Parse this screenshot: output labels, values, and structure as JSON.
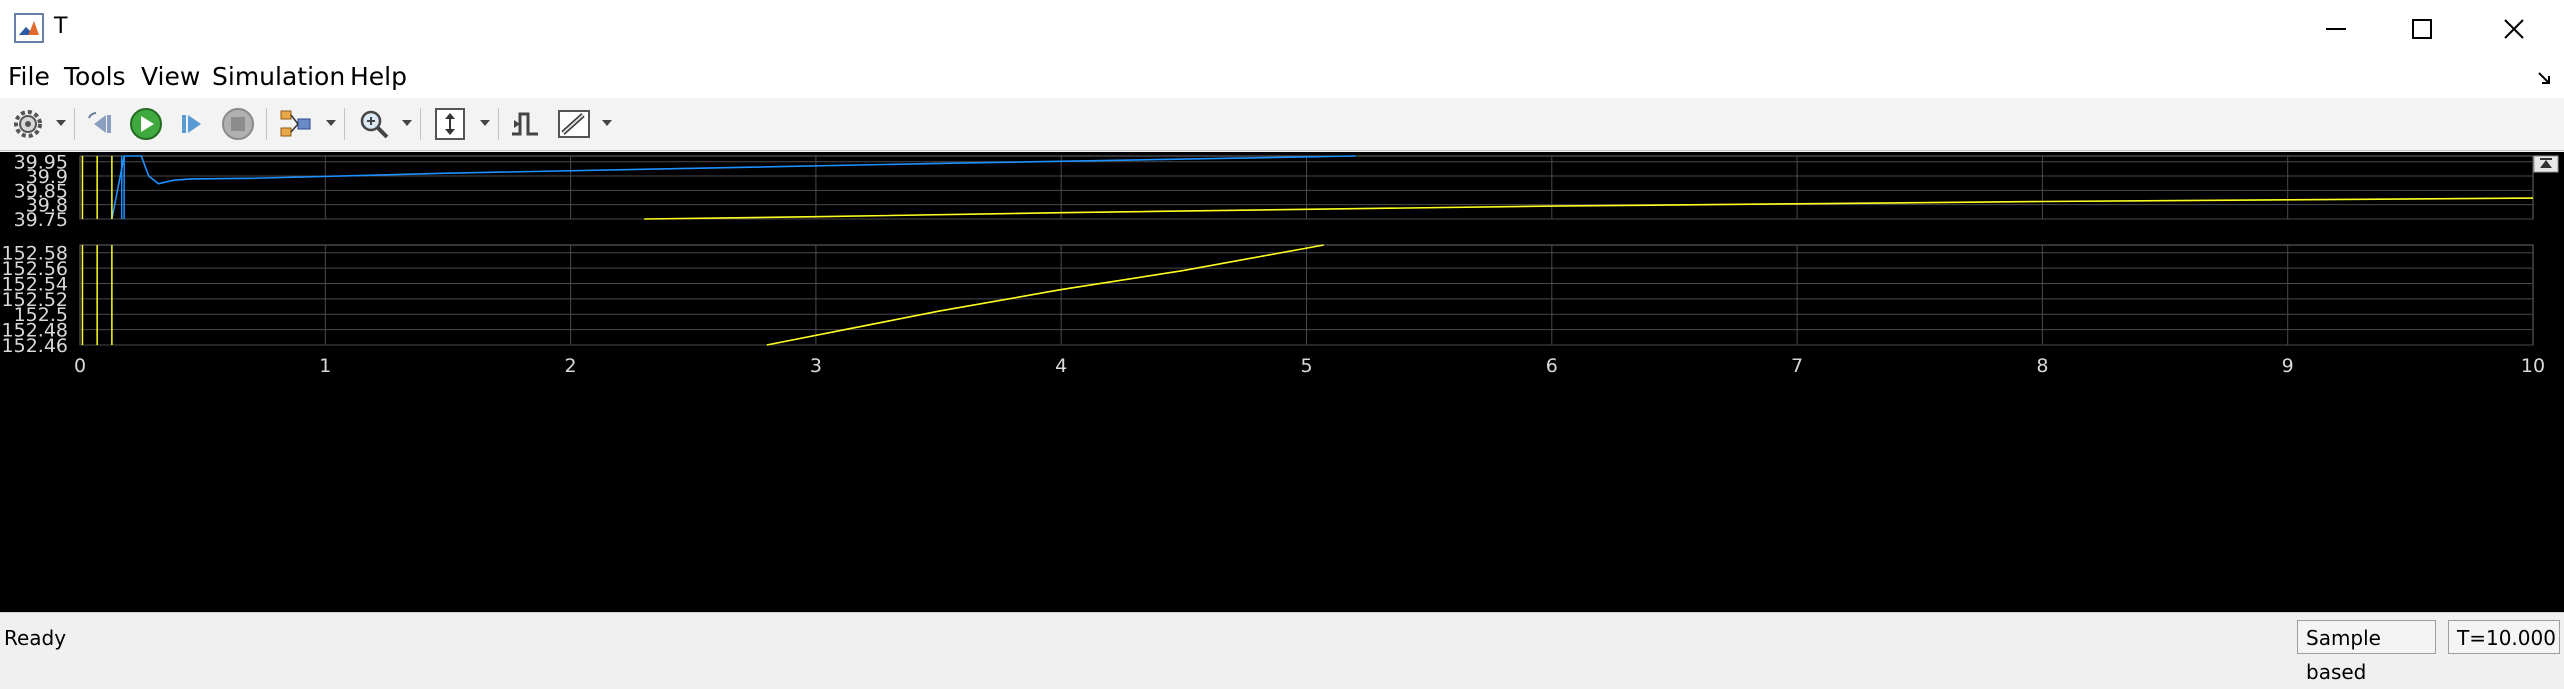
{
  "window": {
    "title": "T"
  },
  "menu": [
    "File",
    "Tools",
    "View",
    "Simulation",
    "Help"
  ],
  "toolbar": {
    "icons": [
      "settings-icon",
      "step-back-icon",
      "run-icon",
      "step-forward-icon",
      "stop-icon",
      "layout-icon",
      "zoom-icon",
      "scale-axes-icon",
      "triggers-icon",
      "measurements-icon"
    ]
  },
  "status": {
    "text": "Ready",
    "mode": "Sample based",
    "time": "T=10.000"
  },
  "colors": {
    "blue_trace": "#1e90ff",
    "yellow_trace": "#ffff22",
    "grid": "#4a4a4a",
    "background": "#000000",
    "axis_text": "#d9d9d9"
  },
  "chart_data": [
    {
      "type": "line",
      "xlim": [
        0,
        10
      ],
      "ylim": [
        39.75,
        39.97
      ],
      "y_ticks": [
        "39.95",
        "39.9",
        "39.85",
        "39.8",
        "39.75"
      ],
      "grid": true,
      "series": [
        {
          "color": "#1e90ff",
          "points": [
            [
              0.13,
              39.75
            ],
            [
              0.18,
              39.97
            ],
            [
              0.25,
              39.97
            ],
            [
              0.28,
              39.9
            ],
            [
              0.32,
              39.873
            ],
            [
              0.38,
              39.885
            ],
            [
              0.45,
              39.89
            ],
            [
              0.7,
              39.892
            ],
            [
              1.5,
              39.91
            ],
            [
              2.5,
              39.927
            ],
            [
              3.5,
              39.944
            ],
            [
              4.5,
              39.959
            ],
            [
              5.2,
              39.97
            ]
          ]
        },
        {
          "color": "#ffff22",
          "points": [
            [
              2.3,
              39.75
            ],
            [
              3,
              39.758
            ],
            [
              4,
              39.772
            ],
            [
              5,
              39.784
            ],
            [
              6,
              39.795
            ],
            [
              7,
              39.803
            ],
            [
              8,
              39.811
            ],
            [
              9,
              39.817
            ],
            [
              10,
              39.823
            ]
          ]
        }
      ]
    },
    {
      "type": "line",
      "xlim": [
        0,
        10
      ],
      "ylim": [
        152.46,
        152.59
      ],
      "y_ticks": [
        "152.58",
        "152.56",
        "152.54",
        "152.52",
        "152.5",
        "152.48",
        "152.46"
      ],
      "x_ticks": [
        "0",
        "1",
        "2",
        "3",
        "4",
        "5",
        "6",
        "7",
        "8",
        "9",
        "10"
      ],
      "grid": true,
      "series": [
        {
          "color": "#ffff22",
          "points": [
            [
              2.8,
              152.46
            ],
            [
              3.5,
              152.504
            ],
            [
              4,
              152.532
            ],
            [
              4.5,
              152.557
            ],
            [
              5.07,
              152.59
            ]
          ]
        }
      ]
    }
  ]
}
